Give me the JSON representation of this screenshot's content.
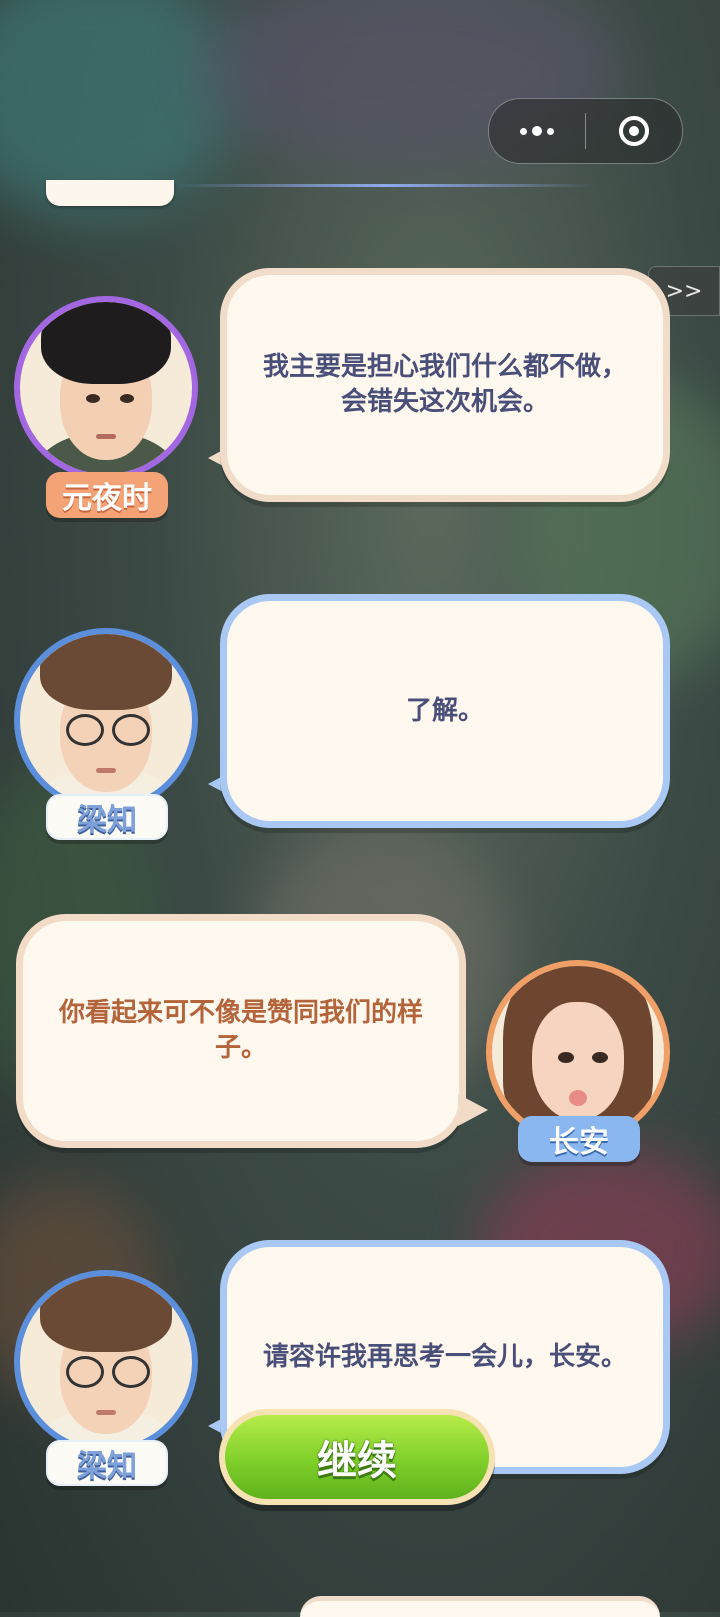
{
  "capsule": {
    "more_icon": "more-dots-icon",
    "close_icon": "target-circle-icon"
  },
  "skip_label": ">>",
  "dialogue": [
    {
      "speaker": "元夜时",
      "text": "我主要是担心我们什么都不做，\n会错失这次机会。"
    },
    {
      "speaker": "梁知",
      "text": "了解。"
    },
    {
      "speaker": "长安",
      "text": "你看起来可不像是赞同我们的样\n子。"
    },
    {
      "speaker": "梁知",
      "text": "请容许我再思考一会儿，长安。"
    }
  ],
  "continue_label": "继续",
  "colors": {
    "purple_ring": "#a467e2",
    "blue_ring": "#5c8fdb",
    "orange_ring": "#f0a066",
    "continue_green": "#7fcf2a",
    "bubble_fill": "#fff8ee"
  }
}
